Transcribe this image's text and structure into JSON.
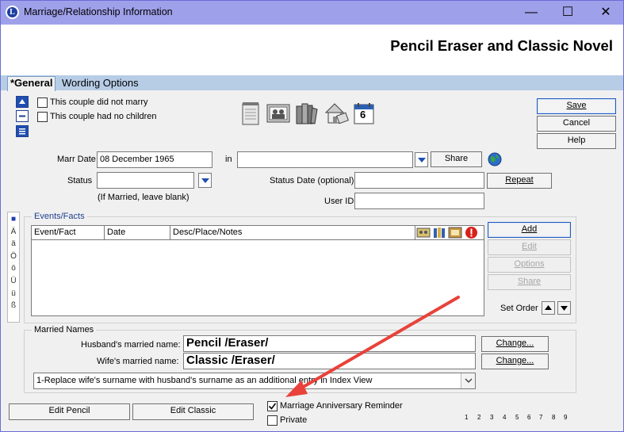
{
  "window": {
    "title": "Marriage/Relationship Information",
    "app_icon_letter": "L",
    "minimize_glyph": "—",
    "maximize_glyph": "☐",
    "close_glyph": "✕"
  },
  "header": {
    "couple_name": "Pencil Eraser and Classic Novel"
  },
  "tabs": [
    {
      "label": "*General",
      "active": true
    },
    {
      "label": "Wording Options",
      "active": false
    }
  ],
  "checkboxes": {
    "did_not_marry": {
      "label": "This couple did not marry",
      "checked": false
    },
    "no_children": {
      "label": "This couple had no children",
      "checked": false
    },
    "anniversary_reminder": {
      "label": "Marriage Anniversary Reminder",
      "checked": true
    },
    "private": {
      "label": "Private",
      "checked": false
    }
  },
  "toolbar_icons": [
    "notes-icon",
    "media-icon",
    "sources-icon",
    "home-address-icon",
    "calendar-icon"
  ],
  "calendar_day": "6",
  "actions": {
    "save": "Save",
    "cancel": "Cancel",
    "help": "Help"
  },
  "marriage": {
    "date_label": "Marr Date",
    "date_value": "08 December 1965",
    "in_label": "in",
    "place_value": "",
    "share_label": "Share",
    "status_label": "Status",
    "status_value": "",
    "status_hint": "(If Married, leave blank)",
    "status_date_label": "Status Date (optional)",
    "status_date_value": "",
    "repeat_label": "Repeat",
    "user_id_label": "User ID",
    "user_id_value": ""
  },
  "special_chars": [
    "■",
    "Ä",
    "ä",
    "Ö",
    "ö",
    "Ü",
    "ü",
    "ß"
  ],
  "events": {
    "group_label": "Events/Facts",
    "columns": [
      "Event/Fact",
      "Date",
      "Desc/Place/Notes"
    ],
    "rows": [],
    "buttons": {
      "add": "Add",
      "edit": "Edit",
      "options": "Options",
      "share": "Share"
    },
    "set_order_label": "Set Order"
  },
  "married_names": {
    "group_label": "Married Names",
    "husband_label": "Husband's married name:",
    "husband_value": "Pencil /Eraser/",
    "wife_label": "Wife's married name:",
    "wife_value": "Classic /Eraser/",
    "change_label": "Change...",
    "index_option": "1-Replace wife's surname with husband's surname as an additional entry in Index View"
  },
  "bottom_buttons": {
    "edit_husband": "Edit Pencil",
    "edit_wife": "Edit Classic"
  },
  "page_numbers": [
    "1",
    "2",
    "3",
    "4",
    "5",
    "6",
    "7",
    "8",
    "9"
  ],
  "colors": {
    "titlebar": "#9fa0ea",
    "tabstrip": "#b7cde6",
    "accent_blue": "#1f4fb0",
    "annotation_arrow": "#e8423a"
  }
}
